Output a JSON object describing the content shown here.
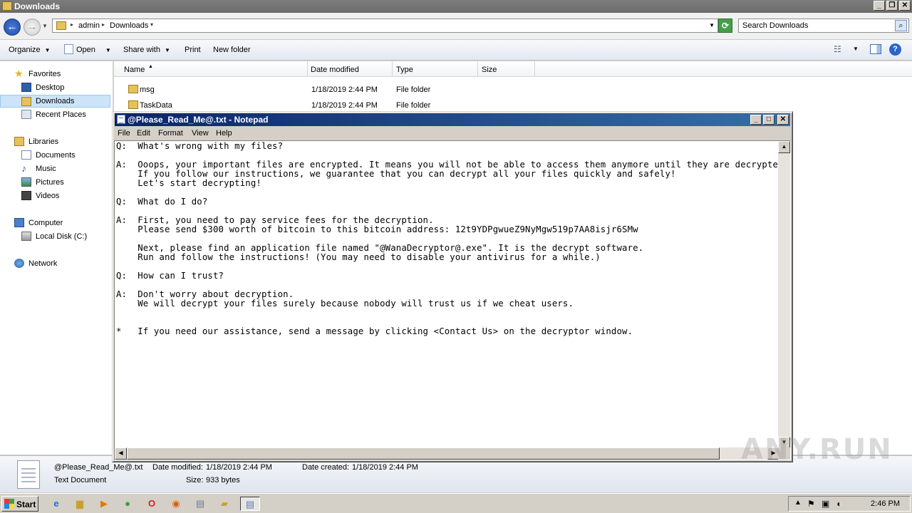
{
  "explorer": {
    "title": "Downloads",
    "breadcrumb": [
      "admin",
      "Downloads"
    ],
    "search_placeholder": "Search Downloads",
    "toolbar": {
      "organize": "Organize",
      "open": "Open",
      "share_with": "Share with",
      "print": "Print",
      "new_folder": "New folder"
    },
    "nav": {
      "favorites": "Favorites",
      "desktop": "Desktop",
      "downloads": "Downloads",
      "recent_places": "Recent Places",
      "libraries": "Libraries",
      "documents": "Documents",
      "music": "Music",
      "pictures": "Pictures",
      "videos": "Videos",
      "computer": "Computer",
      "local_disk": "Local Disk (C:)",
      "network": "Network"
    },
    "columns": {
      "name": "Name",
      "date_modified": "Date modified",
      "type": "Type",
      "size": "Size"
    },
    "files": [
      {
        "name": "msg",
        "date": "1/18/2019 2:44 PM",
        "type": "File folder",
        "size": ""
      },
      {
        "name": "TaskData",
        "date": "1/18/2019 2:44 PM",
        "type": "File folder",
        "size": ""
      }
    ],
    "details": {
      "file_name": "@Please_Read_Me@.txt",
      "date_modified_label": "Date modified:",
      "date_modified": "1/18/2019 2:44 PM",
      "date_created_label": "Date created:",
      "date_created": "1/18/2019 2:44 PM",
      "file_type": "Text Document",
      "size_label": "Size:",
      "size": "933 bytes"
    }
  },
  "notepad": {
    "title": "@Please_Read_Me@.txt - Notepad",
    "menu": [
      "File",
      "Edit",
      "Format",
      "View",
      "Help"
    ],
    "content": "Q:  What's wrong with my files?\n\nA:  Ooops, your important files are encrypted. It means you will not be able to access them anymore until they are decrypted.\n    If you follow our instructions, we guarantee that you can decrypt all your files quickly and safely!\n    Let's start decrypting!\n\nQ:  What do I do?\n\nA:  First, you need to pay service fees for the decryption.\n    Please send $300 worth of bitcoin to this bitcoin address: 12t9YDPgwueZ9NyMgw519p7AA8isjr6SMw\n\n    Next, please find an application file named \"@WanaDecryptor@.exe\". It is the decrypt software.\n    Run and follow the instructions! (You may need to disable your antivirus for a while.)\n\nQ:  How can I trust?\n\nA:  Don't worry about decryption.\n    We will decrypt your files surely because nobody will trust us if we cheat users.\n\n\n*   If you need our assistance, send a message by clicking <Contact Us> on the decryptor window."
  },
  "watermark": "ANY.RUN",
  "taskbar": {
    "start_label": "Start",
    "clock": "2:46 PM"
  },
  "icons": {
    "back": "back-arrow-icon",
    "forward": "forward-arrow-icon",
    "search": "magnifier-icon",
    "folder": "folder-icon"
  },
  "colors": {
    "notepad_title_start": "#0a246a",
    "notepad_title_end": "#3a6ea5",
    "selection": "#cce4f7"
  }
}
